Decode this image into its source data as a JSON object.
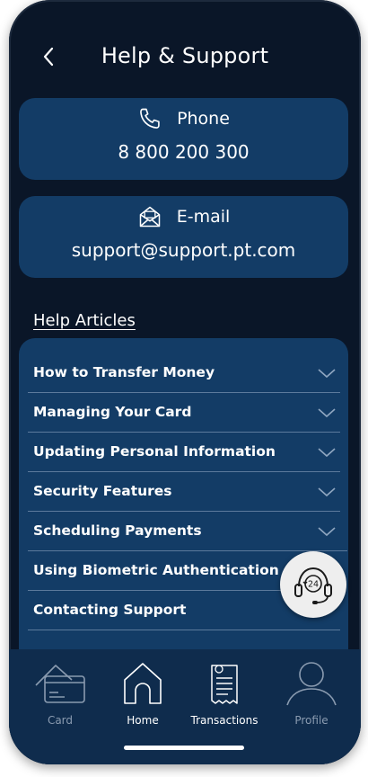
{
  "header": {
    "title": "Help & Support"
  },
  "contacts": {
    "phone": {
      "label": "Phone",
      "value": "8 800 200 300",
      "icon": "phone-icon"
    },
    "email": {
      "label": "E-mail",
      "value": "support@support.pt.com",
      "icon": "email-icon"
    }
  },
  "help": {
    "title": "Help Articles",
    "articles": [
      {
        "label": "How to Transfer Money"
      },
      {
        "label": "Managing Your Card"
      },
      {
        "label": "Updating Personal Information"
      },
      {
        "label": "Security Features"
      },
      {
        "label": "Scheduling Payments"
      },
      {
        "label": "Using Biometric Authentication"
      },
      {
        "label": "Contacting Support"
      }
    ]
  },
  "support_fab": {
    "icon": "support-24-headset-icon",
    "badge": "24"
  },
  "nav": {
    "items": [
      {
        "label": "Card",
        "icon": "card-icon",
        "active": false
      },
      {
        "label": "Home",
        "icon": "home-icon",
        "active": true
      },
      {
        "label": "Transactions",
        "icon": "receipt-icon",
        "active": true
      },
      {
        "label": "Profile",
        "icon": "profile-icon",
        "active": false
      }
    ]
  },
  "colors": {
    "background": "#0a1628",
    "card": "#133c66",
    "nav": "#0f2c4d",
    "nav_active": "#ffffff",
    "nav_inactive": "#8a9bb0"
  }
}
